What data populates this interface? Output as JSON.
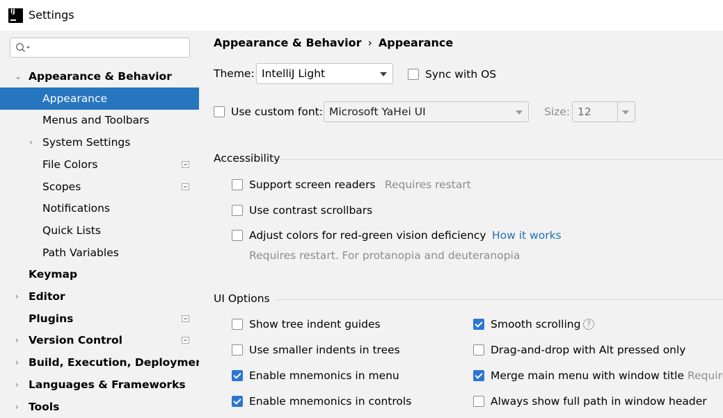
{
  "window": {
    "title": "Settings"
  },
  "search": {
    "placeholder": ""
  },
  "sidebar": {
    "items": [
      {
        "label": "Appearance & Behavior"
      },
      {
        "label": "Appearance"
      },
      {
        "label": "Menus and Toolbars"
      },
      {
        "label": "System Settings"
      },
      {
        "label": "File Colors"
      },
      {
        "label": "Scopes"
      },
      {
        "label": "Notifications"
      },
      {
        "label": "Quick Lists"
      },
      {
        "label": "Path Variables"
      },
      {
        "label": "Keymap"
      },
      {
        "label": "Editor"
      },
      {
        "label": "Plugins"
      },
      {
        "label": "Version Control"
      },
      {
        "label": "Build, Execution, Deployment"
      },
      {
        "label": "Languages & Frameworks"
      },
      {
        "label": "Tools"
      }
    ]
  },
  "breadcrumb": {
    "parent": "Appearance & Behavior",
    "separator": "›",
    "current": "Appearance"
  },
  "theme": {
    "label": "Theme:",
    "value": "IntelliJ Light",
    "sync_label": "Sync with OS"
  },
  "font": {
    "custom_label": "Use custom font:",
    "value": "Microsoft YaHei UI",
    "size_label": "Size:",
    "size_value": "12"
  },
  "accessibility": {
    "title": "Accessibility",
    "screen_readers": "Support screen readers",
    "screen_readers_hint": "Requires restart",
    "contrast_scrollbars": "Use contrast scrollbars",
    "color_deficiency": "Adjust colors for red-green vision deficiency",
    "how_it_works": "How it works",
    "deficiency_hint": "Requires restart. For protanopia and deuteranopia"
  },
  "ui_options": {
    "title": "UI Options",
    "tree_indent_guides": "Show tree indent guides",
    "smaller_indents": "Use smaller indents in trees",
    "mnemonics_menu": "Enable mnemonics in menu",
    "mnemonics_controls": "Enable mnemonics in controls",
    "smooth_scrolling": "Smooth scrolling",
    "help_glyph": "?",
    "drag_drop_alt": "Drag-and-drop with Alt pressed only",
    "merge_main_menu": "Merge main menu with window title",
    "merge_hint": "Require",
    "full_path_header": "Always show full path in window header"
  },
  "colors": {
    "selection": "#2675bf",
    "checkbox_checked": "#2d77d0",
    "link": "#2470b3"
  }
}
